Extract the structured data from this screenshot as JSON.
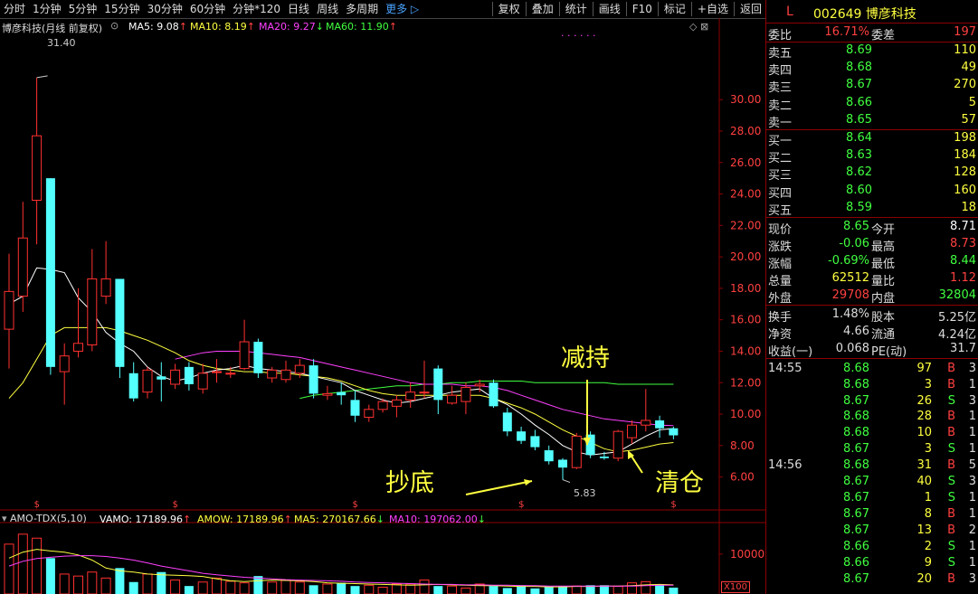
{
  "toolbar": {
    "left_items": [
      "分时",
      "1分钟",
      "5分钟",
      "15分钟",
      "30分钟",
      "60分钟",
      "分钟*120",
      "日线",
      "周线",
      "多周期"
    ],
    "more": "更多 ▷",
    "right_items": [
      "复权",
      "叠加",
      "统计",
      "画线",
      "F10",
      "标记",
      "+自选",
      "返回"
    ]
  },
  "legend": {
    "title": "博彦科技(月线 前复权)",
    "ma5": "MA5: 9.08",
    "ma10": "MA10: 8.19",
    "ma20": "MA20: 9.27",
    "ma60": "MA60: 11.90",
    "arrow_up": "↑",
    "arrow_down": "↓",
    "dots": ". . .   . . ."
  },
  "vol_legend": {
    "name": "AMO-TDX(5,10)",
    "vamo": "VAMO: 17189.96",
    "amow": "AMOW: 17189.96",
    "ma5": "MA5: 270167.66",
    "ma10": "MA10: 197062.00",
    "scale": "X100"
  },
  "annotations": {
    "chaodi": "抄底",
    "jianchi": "减持",
    "qingcang": "清仓",
    "high_label": "31.40",
    "low_label": "5.83"
  },
  "chart_data": {
    "type": "candlestick",
    "ylim": [
      5.0,
      33.0
    ],
    "y_ticks": [
      6.0,
      8.0,
      10.0,
      12.0,
      14.0,
      16.0,
      18.0,
      20.0,
      22.0,
      24.0,
      26.0,
      28.0,
      30.0
    ],
    "vol_ticks": [
      10000
    ],
    "candles": [
      {
        "o": 15.4,
        "c": 17.8,
        "h": 20.2,
        "l": 12.9
      },
      {
        "o": 17.5,
        "c": 21.2,
        "h": 23.5,
        "l": 16.5
      },
      {
        "o": 23.6,
        "c": 27.7,
        "h": 31.4,
        "l": 20.8
      },
      {
        "o": 25.0,
        "c": 13.0,
        "h": 25.0,
        "l": 12.5
      },
      {
        "o": 12.7,
        "c": 13.7,
        "h": 14.5,
        "l": 10.6
      },
      {
        "o": 14.0,
        "c": 14.5,
        "h": 18.0,
        "l": 13.6
      },
      {
        "o": 14.4,
        "c": 18.6,
        "h": 20.5,
        "l": 14.0
      },
      {
        "o": 17.5,
        "c": 18.6,
        "h": 21.0,
        "l": 17.0
      },
      {
        "o": 18.6,
        "c": 13.0,
        "h": 18.6,
        "l": 12.3
      },
      {
        "o": 12.6,
        "c": 11.0,
        "h": 13.3,
        "l": 10.8
      },
      {
        "o": 11.4,
        "c": 12.8,
        "h": 13.0,
        "l": 11.0
      },
      {
        "o": 12.4,
        "c": 12.2,
        "h": 13.3,
        "l": 10.8
      },
      {
        "o": 11.9,
        "c": 12.8,
        "h": 13.2,
        "l": 11.6
      },
      {
        "o": 13.0,
        "c": 11.9,
        "h": 13.3,
        "l": 11.5
      },
      {
        "o": 11.6,
        "c": 12.6,
        "h": 13.2,
        "l": 11.3
      },
      {
        "o": 12.7,
        "c": 12.7,
        "h": 13.5,
        "l": 12.0
      },
      {
        "o": 12.6,
        "c": 12.6,
        "h": 13.0,
        "l": 12.3
      },
      {
        "o": 12.9,
        "c": 14.6,
        "h": 16.0,
        "l": 12.8
      },
      {
        "o": 14.6,
        "c": 12.6,
        "h": 14.8,
        "l": 12.3
      },
      {
        "o": 12.3,
        "c": 12.8,
        "h": 13.0,
        "l": 12.0
      },
      {
        "o": 12.2,
        "c": 12.8,
        "h": 13.4,
        "l": 12.0
      },
      {
        "o": 12.6,
        "c": 13.1,
        "h": 13.5,
        "l": 12.3
      },
      {
        "o": 13.1,
        "c": 11.3,
        "h": 13.5,
        "l": 11.0
      },
      {
        "o": 11.2,
        "c": 11.3,
        "h": 11.8,
        "l": 10.9
      },
      {
        "o": 11.4,
        "c": 11.2,
        "h": 12.0,
        "l": 10.6
      },
      {
        "o": 10.9,
        "c": 9.9,
        "h": 11.5,
        "l": 9.5
      },
      {
        "o": 9.8,
        "c": 10.3,
        "h": 10.6,
        "l": 9.5
      },
      {
        "o": 10.3,
        "c": 10.8,
        "h": 11.0,
        "l": 10.1
      },
      {
        "o": 10.5,
        "c": 10.9,
        "h": 11.2,
        "l": 9.8
      },
      {
        "o": 10.9,
        "c": 11.4,
        "h": 12.0,
        "l": 10.4
      },
      {
        "o": 11.4,
        "c": 11.4,
        "h": 13.4,
        "l": 11.0
      },
      {
        "o": 12.9,
        "c": 10.9,
        "h": 13.1,
        "l": 10.0
      },
      {
        "o": 10.7,
        "c": 11.2,
        "h": 11.8,
        "l": 10.6
      },
      {
        "o": 10.8,
        "c": 11.7,
        "h": 12.0,
        "l": 10.0
      },
      {
        "o": 11.8,
        "c": 11.9,
        "h": 12.2,
        "l": 11.4
      },
      {
        "o": 12.0,
        "c": 10.5,
        "h": 12.2,
        "l": 10.4
      },
      {
        "o": 10.1,
        "c": 8.9,
        "h": 10.4,
        "l": 8.6
      },
      {
        "o": 8.9,
        "c": 8.3,
        "h": 9.2,
        "l": 8.1
      },
      {
        "o": 8.6,
        "c": 7.9,
        "h": 9.0,
        "l": 7.7
      },
      {
        "o": 7.7,
        "c": 7.0,
        "h": 8.0,
        "l": 6.8
      },
      {
        "o": 7.1,
        "c": 6.6,
        "h": 7.2,
        "l": 5.83
      },
      {
        "o": 6.6,
        "c": 8.6,
        "h": 8.8,
        "l": 6.5
      },
      {
        "o": 8.7,
        "c": 7.4,
        "h": 8.9,
        "l": 7.2
      },
      {
        "o": 7.3,
        "c": 7.2,
        "h": 7.6,
        "l": 7.1
      },
      {
        "o": 7.2,
        "c": 8.9,
        "h": 9.0,
        "l": 7.0
      },
      {
        "o": 8.5,
        "c": 9.3,
        "h": 9.6,
        "l": 8.1
      },
      {
        "o": 9.3,
        "c": 9.6,
        "h": 11.6,
        "l": 8.9
      },
      {
        "o": 9.6,
        "c": 9.1,
        "h": 9.9,
        "l": 8.5
      },
      {
        "o": 9.1,
        "c": 8.65,
        "h": 9.2,
        "l": 8.4
      }
    ],
    "ma5": [
      17.0,
      17.5,
      19.3,
      19.2,
      19.0,
      17.4,
      16.5,
      15.2,
      14.5,
      14.0,
      13.0,
      12.4,
      12.1,
      12.3,
      12.6,
      12.8,
      12.9,
      13.1,
      12.9,
      12.8,
      12.7,
      12.6,
      12.4,
      12.2,
      12.0,
      11.5,
      11.2,
      10.9,
      10.7,
      10.8,
      11.0,
      11.2,
      11.4,
      11.5,
      11.6,
      11.0,
      10.6,
      10.0,
      9.3,
      8.7,
      8.0,
      7.6,
      7.4,
      7.5,
      7.6,
      8.1,
      8.6,
      9.0,
      9.08
    ],
    "ma10": [
      11.0,
      12.0,
      13.5,
      15.0,
      15.5,
      15.5,
      15.5,
      15.5,
      15.3,
      15.0,
      14.7,
      14.3,
      13.9,
      13.4,
      13.1,
      12.9,
      12.8,
      12.7,
      12.7,
      12.6,
      12.6,
      12.5,
      12.4,
      12.3,
      12.1,
      11.8,
      11.5,
      11.3,
      11.2,
      11.2,
      11.2,
      11.2,
      11.2,
      11.2,
      11.2,
      11.0,
      10.7,
      10.4,
      10.0,
      9.5,
      9.0,
      8.6,
      8.2,
      7.8,
      7.6,
      7.7,
      7.9,
      8.1,
      8.19
    ],
    "ma20": [
      null,
      null,
      null,
      null,
      null,
      null,
      null,
      null,
      null,
      null,
      null,
      null,
      13.5,
      13.7,
      13.9,
      14.0,
      14.0,
      14.0,
      13.9,
      13.8,
      13.7,
      13.6,
      13.4,
      13.2,
      13.0,
      12.8,
      12.6,
      12.4,
      12.2,
      12.0,
      11.9,
      11.9,
      11.9,
      11.8,
      11.8,
      11.7,
      11.5,
      11.2,
      10.9,
      10.6,
      10.3,
      10.1,
      9.9,
      9.7,
      9.6,
      9.5,
      9.4,
      9.3,
      9.27
    ],
    "ma60": [
      null,
      null,
      null,
      null,
      null,
      null,
      null,
      null,
      null,
      null,
      null,
      null,
      null,
      null,
      null,
      null,
      null,
      null,
      null,
      null,
      null,
      11.0,
      11.2,
      11.3,
      11.4,
      11.5,
      11.6,
      11.7,
      11.8,
      11.8,
      11.9,
      11.9,
      12.0,
      12.0,
      12.1,
      12.1,
      12.1,
      12.1,
      12.0,
      12.0,
      12.0,
      12.0,
      12.0,
      12.0,
      11.9,
      11.9,
      11.9,
      11.9,
      11.9
    ],
    "volumes": [
      12500,
      15000,
      14000,
      9000,
      5000,
      4500,
      5500,
      4000,
      6500,
      3000,
      5000,
      5500,
      3500,
      2000,
      3000,
      4000,
      3200,
      2800,
      4500,
      3000,
      3500,
      3000,
      2200,
      2500,
      2800,
      2000,
      2200,
      1700,
      2500,
      2500,
      3500,
      2000,
      2000,
      1500,
      2500,
      2000,
      1500,
      2200,
      1400,
      1800,
      2000,
      2000,
      2200,
      2200,
      1900,
      2800,
      3100,
      2400,
      1600
    ],
    "vol_ma5": [
      9000,
      10500,
      11200,
      10800,
      10500,
      9800,
      8500,
      6500,
      5800,
      5500,
      5000,
      4800,
      4700,
      4600,
      4400,
      3800,
      3300,
      3100,
      3300,
      3500,
      3400,
      3300,
      3100,
      2800,
      2700,
      2600,
      2500,
      2400,
      2300,
      2200,
      2300,
      2400,
      2300,
      2200,
      2100,
      2100,
      2000,
      1900,
      1900,
      1800,
      1800,
      1900,
      1900,
      2000,
      2000,
      2100,
      2300,
      2400,
      2300
    ],
    "vol_ma10": [
      7000,
      8200,
      8900,
      9200,
      9500,
      9600,
      9600,
      9400,
      9000,
      8500,
      7800,
      7000,
      6400,
      5800,
      5200,
      4800,
      4500,
      4200,
      4000,
      3800,
      3600,
      3500,
      3400,
      3300,
      3200,
      3000,
      2900,
      2800,
      2700,
      2600,
      2500,
      2400,
      2400,
      2300,
      2300,
      2200,
      2200,
      2100,
      2100,
      2000,
      2000,
      2000,
      2000,
      2000,
      2000,
      2000,
      2100,
      2200,
      2200
    ],
    "s_markers_at": [
      2,
      12,
      25,
      37,
      48
    ]
  },
  "right_panel": {
    "code": "L",
    "stock": "002649 博彦科技",
    "weibi_label": "委比",
    "weibi_val": "16.71%",
    "weicha_label": "委差",
    "weicha_val": "197",
    "sell": [
      {
        "label": "卖五",
        "price": "8.69",
        "vol": "110"
      },
      {
        "label": "卖四",
        "price": "8.68",
        "vol": "49"
      },
      {
        "label": "卖三",
        "price": "8.67",
        "vol": "270"
      },
      {
        "label": "卖二",
        "price": "8.66",
        "vol": "5"
      },
      {
        "label": "卖一",
        "price": "8.65",
        "vol": "57"
      }
    ],
    "buy": [
      {
        "label": "买一",
        "price": "8.64",
        "vol": "198"
      },
      {
        "label": "买二",
        "price": "8.63",
        "vol": "184"
      },
      {
        "label": "买三",
        "price": "8.62",
        "vol": "128"
      },
      {
        "label": "买四",
        "price": "8.60",
        "vol": "160"
      },
      {
        "label": "买五",
        "price": "8.59",
        "vol": "18"
      }
    ],
    "quote": [
      {
        "l1": "现价",
        "v1": "8.65",
        "c1": "#40ff40",
        "l2": "今开",
        "v2": "8.71",
        "c2": "#ffffff"
      },
      {
        "l1": "涨跌",
        "v1": "-0.06",
        "c1": "#40ff40",
        "l2": "最高",
        "v2": "8.73",
        "c2": "#ff4040"
      },
      {
        "l1": "涨幅",
        "v1": "-0.69%",
        "c1": "#40ff40",
        "l2": "最低",
        "v2": "8.44",
        "c2": "#40ff40"
      },
      {
        "l1": "总量",
        "v1": "62512",
        "c1": "#ffff40",
        "l2": "量比",
        "v2": "1.12",
        "c2": "#ff4040"
      },
      {
        "l1": "外盘",
        "v1": "29708",
        "c1": "#ff4040",
        "l2": "内盘",
        "v2": "32804",
        "c2": "#40ff40"
      }
    ],
    "stats": [
      {
        "l1": "换手",
        "v1": "1.48%",
        "l2": "股本",
        "v2": "5.25亿"
      },
      {
        "l1": "净资",
        "v1": "4.66",
        "l2": "流通",
        "v2": "4.24亿"
      },
      {
        "l1": "收益(一)",
        "v1": "0.068",
        "l2": "PE(动)",
        "v2": "31.7"
      }
    ],
    "ticks1_time": "14:55",
    "ticks1": [
      {
        "p": "8.68",
        "v": "97",
        "bs": "B",
        "n": "3"
      },
      {
        "p": "8.68",
        "v": "3",
        "bs": "B",
        "n": "1"
      },
      {
        "p": "8.67",
        "v": "26",
        "bs": "S",
        "n": "3"
      },
      {
        "p": "8.68",
        "v": "28",
        "bs": "B",
        "n": "1"
      },
      {
        "p": "8.68",
        "v": "10",
        "bs": "B",
        "n": "1"
      },
      {
        "p": "8.67",
        "v": "3",
        "bs": "S",
        "n": "1"
      }
    ],
    "ticks2_time": "14:56",
    "ticks2": [
      {
        "p": "8.68",
        "v": "31",
        "bs": "B",
        "n": "5"
      },
      {
        "p": "8.67",
        "v": "40",
        "bs": "S",
        "n": "3"
      },
      {
        "p": "8.67",
        "v": "1",
        "bs": "S",
        "n": "1"
      },
      {
        "p": "8.67",
        "v": "8",
        "bs": "B",
        "n": "1"
      },
      {
        "p": "8.67",
        "v": "13",
        "bs": "B",
        "n": "2"
      },
      {
        "p": "8.66",
        "v": "2",
        "bs": "S",
        "n": "1"
      },
      {
        "p": "8.66",
        "v": "9",
        "bs": "S",
        "n": "1"
      },
      {
        "p": "8.67",
        "v": "20",
        "bs": "B",
        "n": "3"
      }
    ]
  }
}
